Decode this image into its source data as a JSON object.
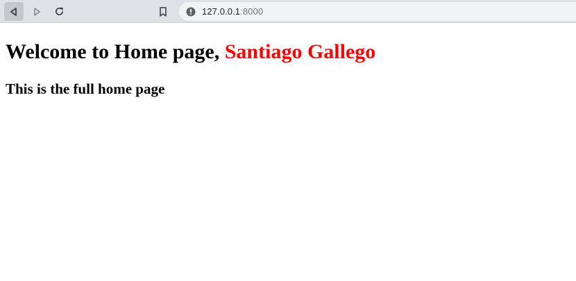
{
  "browser": {
    "url_host": "127.0.0.1",
    "url_port": ":8000",
    "icons": {
      "back": "back-arrow-icon",
      "forward": "forward-arrow-icon",
      "reload": "reload-icon",
      "bookmark": "bookmark-icon",
      "site_info": "info-icon"
    }
  },
  "page": {
    "heading_prefix": "Welcome to Home page, ",
    "user_name": "Santiago Gallego",
    "user_name_color": "#ff0000",
    "subheading": "This is the full home page"
  }
}
